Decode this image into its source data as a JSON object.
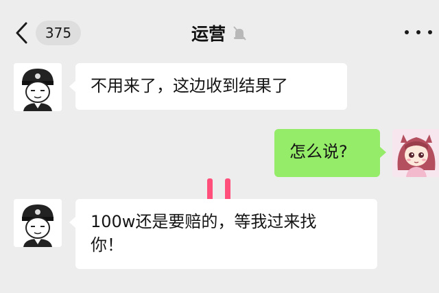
{
  "header": {
    "unread_count": "375",
    "title": "运营",
    "back_icon": "chevron-left-icon",
    "mute_icon": "muted-bell-icon",
    "more_icon": "more-dots-icon"
  },
  "messages": [
    {
      "side": "received",
      "text": "不用来了，这边收到结果了",
      "avatar": "police-cartoon-avatar"
    },
    {
      "side": "sent",
      "text": "怎么说?",
      "avatar": "anime-girl-avatar"
    },
    {
      "side": "received",
      "line1": "100w还是要赔的，等我过来找",
      "line2": "你！",
      "avatar": "police-cartoon-avatar"
    }
  ],
  "overlay": {
    "icon": "pause-icon",
    "color": "#ff4f7a"
  },
  "colors": {
    "background": "#ededed",
    "sent_bubble": "#95ec69",
    "received_bubble": "#ffffff"
  }
}
